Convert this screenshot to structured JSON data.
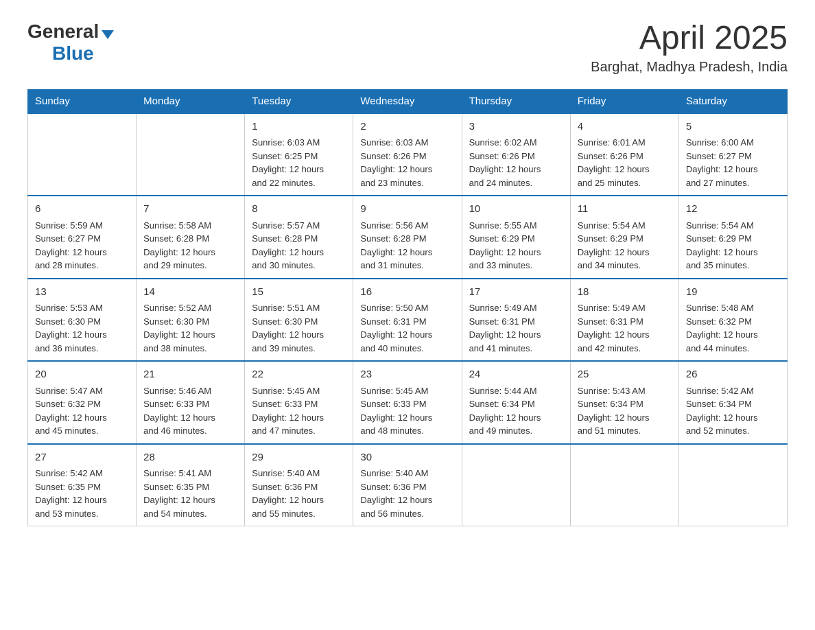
{
  "header": {
    "logo_general": "General",
    "logo_blue": "Blue",
    "month_year": "April 2025",
    "location": "Barghat, Madhya Pradesh, India"
  },
  "days_of_week": [
    "Sunday",
    "Monday",
    "Tuesday",
    "Wednesday",
    "Thursday",
    "Friday",
    "Saturday"
  ],
  "weeks": [
    [
      {
        "day": "",
        "info": ""
      },
      {
        "day": "",
        "info": ""
      },
      {
        "day": "1",
        "info": "Sunrise: 6:03 AM\nSunset: 6:25 PM\nDaylight: 12 hours\nand 22 minutes."
      },
      {
        "day": "2",
        "info": "Sunrise: 6:03 AM\nSunset: 6:26 PM\nDaylight: 12 hours\nand 23 minutes."
      },
      {
        "day": "3",
        "info": "Sunrise: 6:02 AM\nSunset: 6:26 PM\nDaylight: 12 hours\nand 24 minutes."
      },
      {
        "day": "4",
        "info": "Sunrise: 6:01 AM\nSunset: 6:26 PM\nDaylight: 12 hours\nand 25 minutes."
      },
      {
        "day": "5",
        "info": "Sunrise: 6:00 AM\nSunset: 6:27 PM\nDaylight: 12 hours\nand 27 minutes."
      }
    ],
    [
      {
        "day": "6",
        "info": "Sunrise: 5:59 AM\nSunset: 6:27 PM\nDaylight: 12 hours\nand 28 minutes."
      },
      {
        "day": "7",
        "info": "Sunrise: 5:58 AM\nSunset: 6:28 PM\nDaylight: 12 hours\nand 29 minutes."
      },
      {
        "day": "8",
        "info": "Sunrise: 5:57 AM\nSunset: 6:28 PM\nDaylight: 12 hours\nand 30 minutes."
      },
      {
        "day": "9",
        "info": "Sunrise: 5:56 AM\nSunset: 6:28 PM\nDaylight: 12 hours\nand 31 minutes."
      },
      {
        "day": "10",
        "info": "Sunrise: 5:55 AM\nSunset: 6:29 PM\nDaylight: 12 hours\nand 33 minutes."
      },
      {
        "day": "11",
        "info": "Sunrise: 5:54 AM\nSunset: 6:29 PM\nDaylight: 12 hours\nand 34 minutes."
      },
      {
        "day": "12",
        "info": "Sunrise: 5:54 AM\nSunset: 6:29 PM\nDaylight: 12 hours\nand 35 minutes."
      }
    ],
    [
      {
        "day": "13",
        "info": "Sunrise: 5:53 AM\nSunset: 6:30 PM\nDaylight: 12 hours\nand 36 minutes."
      },
      {
        "day": "14",
        "info": "Sunrise: 5:52 AM\nSunset: 6:30 PM\nDaylight: 12 hours\nand 38 minutes."
      },
      {
        "day": "15",
        "info": "Sunrise: 5:51 AM\nSunset: 6:30 PM\nDaylight: 12 hours\nand 39 minutes."
      },
      {
        "day": "16",
        "info": "Sunrise: 5:50 AM\nSunset: 6:31 PM\nDaylight: 12 hours\nand 40 minutes."
      },
      {
        "day": "17",
        "info": "Sunrise: 5:49 AM\nSunset: 6:31 PM\nDaylight: 12 hours\nand 41 minutes."
      },
      {
        "day": "18",
        "info": "Sunrise: 5:49 AM\nSunset: 6:31 PM\nDaylight: 12 hours\nand 42 minutes."
      },
      {
        "day": "19",
        "info": "Sunrise: 5:48 AM\nSunset: 6:32 PM\nDaylight: 12 hours\nand 44 minutes."
      }
    ],
    [
      {
        "day": "20",
        "info": "Sunrise: 5:47 AM\nSunset: 6:32 PM\nDaylight: 12 hours\nand 45 minutes."
      },
      {
        "day": "21",
        "info": "Sunrise: 5:46 AM\nSunset: 6:33 PM\nDaylight: 12 hours\nand 46 minutes."
      },
      {
        "day": "22",
        "info": "Sunrise: 5:45 AM\nSunset: 6:33 PM\nDaylight: 12 hours\nand 47 minutes."
      },
      {
        "day": "23",
        "info": "Sunrise: 5:45 AM\nSunset: 6:33 PM\nDaylight: 12 hours\nand 48 minutes."
      },
      {
        "day": "24",
        "info": "Sunrise: 5:44 AM\nSunset: 6:34 PM\nDaylight: 12 hours\nand 49 minutes."
      },
      {
        "day": "25",
        "info": "Sunrise: 5:43 AM\nSunset: 6:34 PM\nDaylight: 12 hours\nand 51 minutes."
      },
      {
        "day": "26",
        "info": "Sunrise: 5:42 AM\nSunset: 6:34 PM\nDaylight: 12 hours\nand 52 minutes."
      }
    ],
    [
      {
        "day": "27",
        "info": "Sunrise: 5:42 AM\nSunset: 6:35 PM\nDaylight: 12 hours\nand 53 minutes."
      },
      {
        "day": "28",
        "info": "Sunrise: 5:41 AM\nSunset: 6:35 PM\nDaylight: 12 hours\nand 54 minutes."
      },
      {
        "day": "29",
        "info": "Sunrise: 5:40 AM\nSunset: 6:36 PM\nDaylight: 12 hours\nand 55 minutes."
      },
      {
        "day": "30",
        "info": "Sunrise: 5:40 AM\nSunset: 6:36 PM\nDaylight: 12 hours\nand 56 minutes."
      },
      {
        "day": "",
        "info": ""
      },
      {
        "day": "",
        "info": ""
      },
      {
        "day": "",
        "info": ""
      }
    ]
  ]
}
